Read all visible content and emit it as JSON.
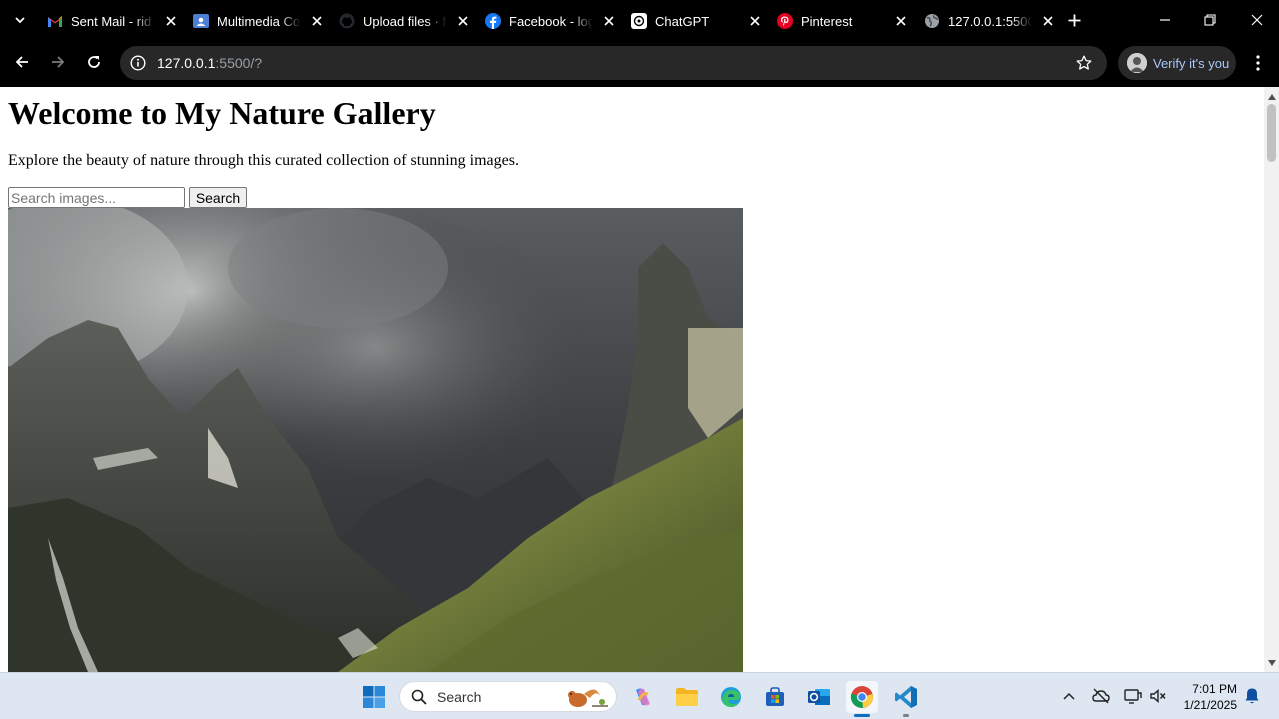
{
  "tabs": [
    {
      "title": "Sent Mail - rid",
      "icon": "gmail-icon"
    },
    {
      "title": "Multimedia Co",
      "icon": "google-classroom-icon"
    },
    {
      "title": "Upload files · f",
      "icon": "github-icon"
    },
    {
      "title": "Facebook - log",
      "icon": "facebook-icon"
    },
    {
      "title": "ChatGPT",
      "icon": "chatgpt-icon"
    },
    {
      "title": "Pinterest",
      "icon": "pinterest-icon"
    },
    {
      "title": "127.0.0.1:5500",
      "icon": "globe-icon"
    }
  ],
  "address_bar": {
    "host": "127.0.0.1",
    "rest": ":5500/?"
  },
  "profile": {
    "label": "Verify it's you"
  },
  "page": {
    "heading": "Welcome to My Nature Gallery",
    "description": "Explore the beauty of nature through this curated collection of stunning images.",
    "search_placeholder": "Search images...",
    "search_button": "Search"
  },
  "taskbar": {
    "search_label": "Search",
    "apps": [
      "windows-start-icon",
      "copilot-icon",
      "file-explorer-icon",
      "edge-icon",
      "microsoft-store-icon",
      "outlook-icon",
      "chrome-icon",
      "vscode-icon"
    ],
    "active_app": "chrome-icon",
    "time": "7:01 PM",
    "date": "1/21/2025"
  },
  "colors": {
    "accent": "#a8c7fa",
    "chrome_dark": "#000000",
    "omnibox": "#282828",
    "taskbar": "#dde6f1"
  }
}
